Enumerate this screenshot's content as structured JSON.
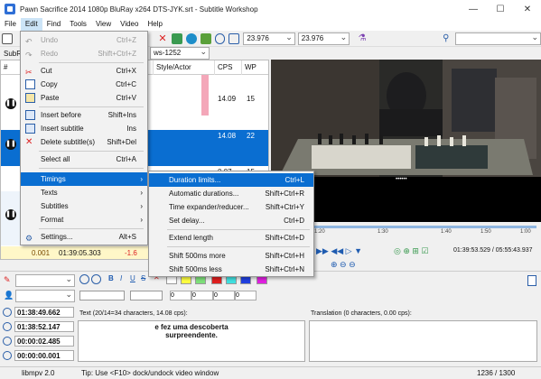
{
  "window": {
    "title": "Pawn Sacrifice 2014 1080p BluRay x264 DTS-JYK.srt - Subtitle Workshop",
    "minimize": "—",
    "maximize": "☐",
    "close": "✕"
  },
  "menubar": [
    "File",
    "Edit",
    "Find",
    "Tools",
    "View",
    "Video",
    "Help"
  ],
  "toolbar": {
    "fps1": "23.976",
    "fps2": "23.976",
    "format_partial": "SubR",
    "encoding_partial": "ws-1252"
  },
  "grid": {
    "headers": {
      "num": "#",
      "style": "Style/Actor",
      "cps": "CPS",
      "wp": "WP"
    },
    "rows": [
      {
        "cps": "14.09",
        "wp": "15"
      },
      {
        "cps": "14.08",
        "wp": "22"
      },
      {
        "cps": "0.07",
        "wp": "15"
      },
      {
        "num": "0.001",
        "time": "01:39:05.303",
        "dur": "-1.6"
      }
    ]
  },
  "timeline_labels": [
    "1:20",
    "1:30",
    "1:40",
    "1:50",
    "1:00"
  ],
  "video": {
    "position": "01:39:53.529 / 05:55:43.937",
    "seek_label": "••••••"
  },
  "editor": {
    "start": "01:38:49.662",
    "end": "01:38:52.147",
    "duration": "00:00:02.485",
    "pause": "00:00:00.001",
    "text_label": "Text (20/14=34 characters, 14.08 cps):",
    "text_line1": "e fez uma descoberta",
    "text_line2": "surpreendente.",
    "translation_label": "Translation (0 characters, 0.00 cps):",
    "num_fields": [
      "0",
      "0",
      "0",
      "0"
    ]
  },
  "status": {
    "left": "libmpv 2.0",
    "tip": "Tip: Use <F10> dock/undock video window",
    "count": "1236 / 1300"
  },
  "edit_menu": [
    {
      "label": "Undo",
      "shortcut": "Ctrl+Z",
      "disabled": true
    },
    {
      "label": "Redo",
      "shortcut": "Shift+Ctrl+Z",
      "disabled": true
    },
    {
      "label": "Cut",
      "shortcut": "Ctrl+X"
    },
    {
      "label": "Copy",
      "shortcut": "Ctrl+C"
    },
    {
      "label": "Paste",
      "shortcut": "Ctrl+V"
    },
    {
      "label": "Insert before",
      "shortcut": "Shift+Ins"
    },
    {
      "label": "Insert subtitle",
      "shortcut": "Ins"
    },
    {
      "label": "Delete subtitle(s)",
      "shortcut": "Shift+Del"
    },
    {
      "label": "Select all",
      "shortcut": "Ctrl+A"
    },
    {
      "label": "Timings",
      "shortcut": ""
    },
    {
      "label": "Texts",
      "shortcut": ""
    },
    {
      "label": "Subtitles",
      "shortcut": ""
    },
    {
      "label": "Format",
      "shortcut": ""
    },
    {
      "label": "Settings...",
      "shortcut": "Alt+S"
    }
  ],
  "timings_menu": [
    {
      "label": "Duration limits...",
      "shortcut": "Ctrl+L"
    },
    {
      "label": "Automatic durations...",
      "shortcut": "Shift+Ctrl+R"
    },
    {
      "label": "Time expander/reducer...",
      "shortcut": "Shift+Ctrl+Y"
    },
    {
      "label": "Set delay...",
      "shortcut": "Ctrl+D"
    },
    {
      "label": "Extend length",
      "shortcut": "Shift+Ctrl+D"
    },
    {
      "label": "Shift 500ms more",
      "shortcut": "Shift+Ctrl+H"
    },
    {
      "label": "Shift 500ms less",
      "shortcut": "Shift+Ctrl+N"
    }
  ],
  "colors": {
    "accent": "#0a6ed1",
    "highlight_pink": "#f4a7b9",
    "menu_bg": "#f2f2f2"
  }
}
